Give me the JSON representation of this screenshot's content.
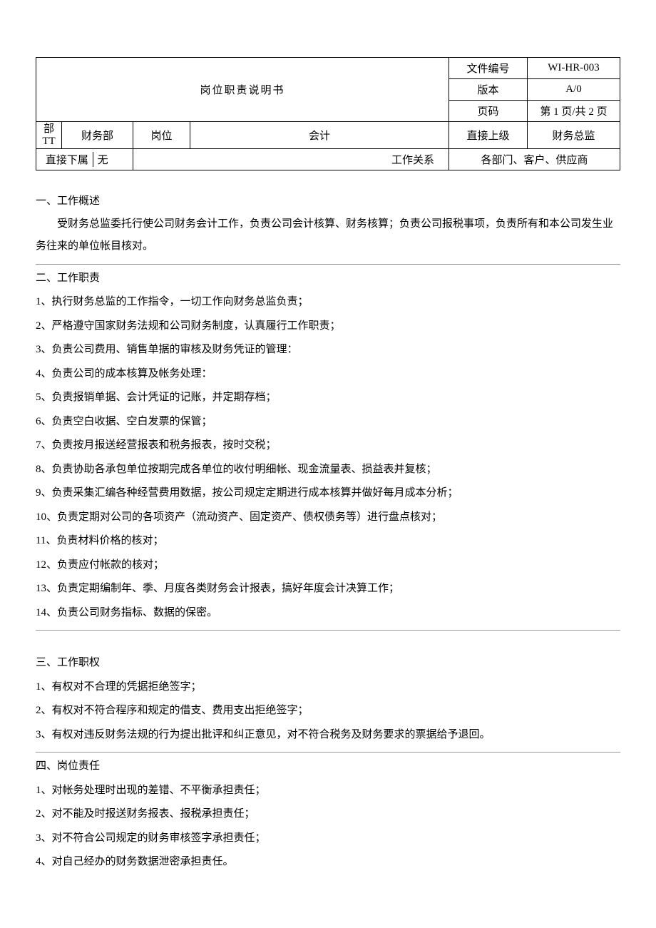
{
  "header": {
    "title": "岗位职责说明书",
    "doc_no_label": "文件编号",
    "doc_no": "WI-HR-003",
    "version_label": "版本",
    "version": "A/0",
    "page_label": "页码",
    "page": "第 1 页/共 2 页",
    "dept_label": "部 TT",
    "dept": "财务部",
    "position_label": "岗位",
    "position": "会计",
    "supervisor_label": "直接上级",
    "supervisor": "财务总监",
    "subordinate_label": "直接下属",
    "subordinate": "无",
    "relation_label": "工作关系",
    "relation": "各部门、客户、供应商"
  },
  "s1": {
    "title": "一、工作概述",
    "body": "受财务总监委托行使公司财务会计工作，负责公司会计核算、财务核算；负责公司报税事项，负责所有和本公司发生业务往来的单位帐目核对。"
  },
  "s2": {
    "title": "二、工作职责",
    "items": [
      "1、执行财务总监的工作指令，一切工作向财务总监负责；",
      "2、严格遵守国家财务法规和公司财务制度，认真履行工作职责；",
      "3、负责公司费用、销售单据的审核及财务凭证的管理：",
      "4、负责公司的成本核算及帐务处理：",
      "5、负责报销单据、会计凭证的记账，并定期存档；",
      "6、负责空白收据、空白发票的保管；",
      "7、负责按月报送经营报表和税务报表，按时交税；",
      "8、负责协助各承包单位按期完成各单位的收付明细帐、现金流量表、损益表并复核；",
      "9、负责采集汇编各种经营费用数据，按公司规定定期进行成本核算并做好每月成本分析；",
      "10、负责定期对公司的各项资产（流动资产、固定资产、债权债务等）进行盘点核对；",
      "11、负责材料价格的核对；",
      "12、负责应付帐款的核对；",
      "13、负责定期编制年、季、月度各类财务会计报表，搞好年度会计决算工作；",
      "14、负责公司财务指标、数据的保密。"
    ]
  },
  "s3": {
    "title": "三、工作职权",
    "items": [
      "1、有权对不合理的凭据拒绝签字；",
      "2、有权对不符合程序和规定的借支、费用支出拒绝签字；",
      "3、有权对违反财务法规的行为提出批评和纠正意见，对不符合税务及财务要求的票据给予退回。"
    ]
  },
  "s4": {
    "title": "四、岗位责任",
    "items": [
      "1、对帐务处理时出现的差错、不平衡承担责任；",
      "2、对不能及时报送财务报表、报税承担责任；",
      "3、对不符合公司规定的财务审核签字承担责任；",
      "4、对自己经办的财务数据泄密承担责任。"
    ]
  }
}
